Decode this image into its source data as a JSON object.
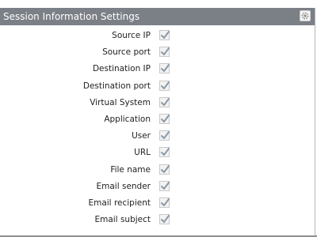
{
  "panel": {
    "title": "Session Information Settings",
    "header_color": "#7b7f86",
    "settings_icon": "gear-icon"
  },
  "fields": [
    {
      "label": "Source IP",
      "checked": true
    },
    {
      "label": "Source port",
      "checked": true
    },
    {
      "label": "Destination IP",
      "checked": true
    },
    {
      "label": "Destination port",
      "checked": true
    },
    {
      "label": "Virtual System",
      "checked": true
    },
    {
      "label": "Application",
      "checked": true
    },
    {
      "label": "User",
      "checked": true
    },
    {
      "label": "URL",
      "checked": true
    },
    {
      "label": "File name",
      "checked": true
    },
    {
      "label": "Email sender",
      "checked": true
    },
    {
      "label": "Email recipient",
      "checked": true
    },
    {
      "label": "Email subject",
      "checked": true
    }
  ]
}
